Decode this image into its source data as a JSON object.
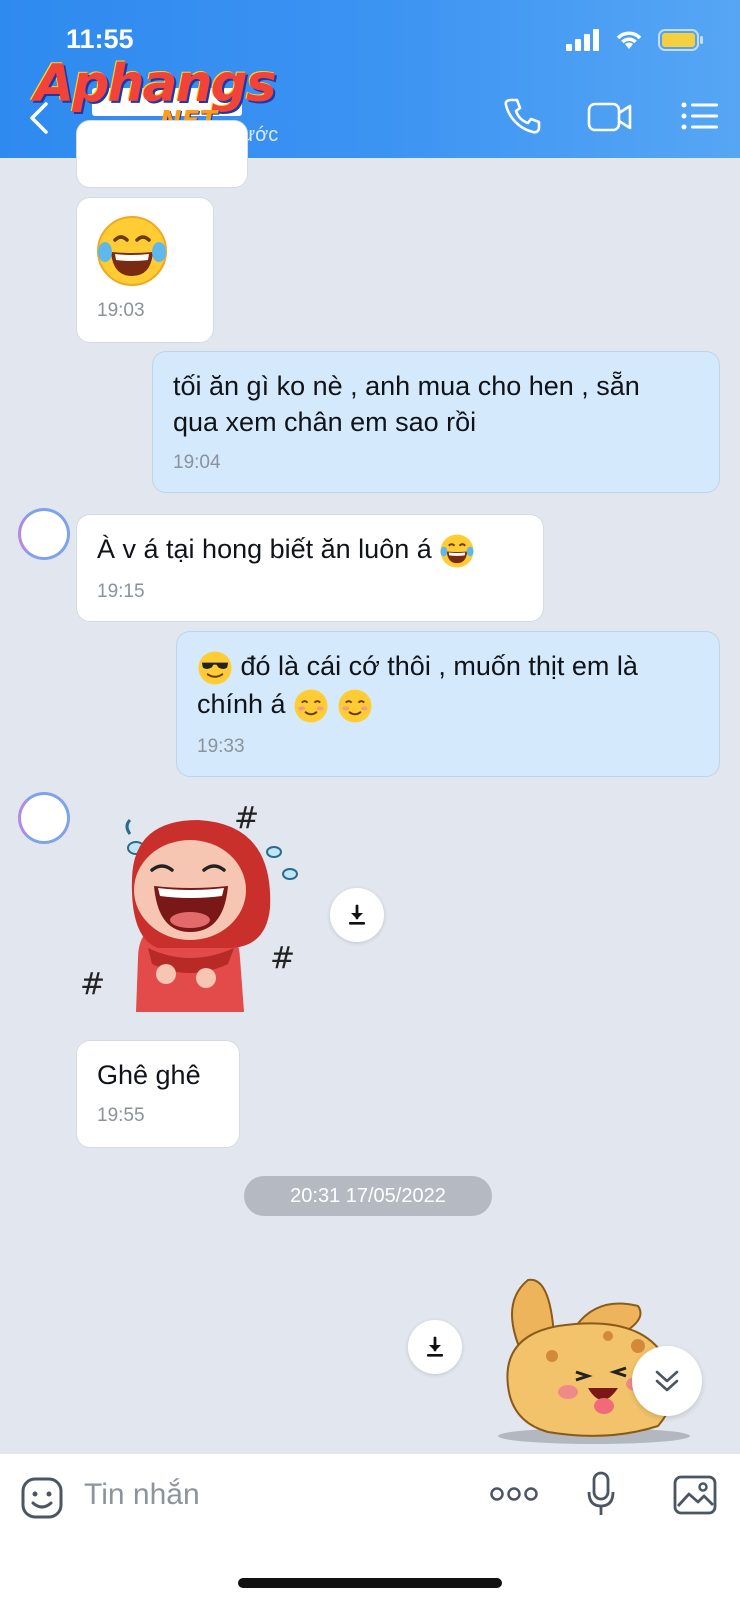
{
  "status_bar": {
    "time": "11:55"
  },
  "header": {
    "logo_main": "Aphangs",
    "logo_sub": ".NET",
    "last_seen": "Truy cập 8 giờ trước"
  },
  "messages": [
    {
      "id": "m1",
      "direction": "in",
      "text": "",
      "time": "19:03",
      "emoji": "laughing-tears"
    },
    {
      "id": "m2",
      "direction": "out",
      "text_line1": "tối ăn gì ko nè , anh mua cho hen , sẵn",
      "text_line2": "qua xem chân em sao rồi",
      "time": "19:04"
    },
    {
      "id": "m3",
      "direction": "in",
      "text": "À v á tại hong biết ăn luôn á",
      "time": "19:15"
    },
    {
      "id": "m4",
      "direction": "out",
      "text_line1": "đó là cái cớ thôi , muốn thịt em là",
      "text_line2": "chính á",
      "time": "19:33"
    },
    {
      "id": "m5",
      "direction": "in",
      "type": "sticker",
      "sticker": "red-hood-girl-laughing"
    },
    {
      "id": "m6",
      "direction": "in",
      "text": "Ghê ghê",
      "time": "19:55"
    },
    {
      "id": "m7",
      "direction": "out",
      "type": "sticker",
      "sticker": "rabbit-laughing"
    }
  ],
  "date_separator": "20:31 17/05/2022",
  "composer": {
    "placeholder": "Tin nhắn"
  },
  "colors": {
    "header": "#3b93f2",
    "bubble_out": "#d5e9fc",
    "bubble_in": "#ffffff",
    "background": "#e2e7ef"
  }
}
